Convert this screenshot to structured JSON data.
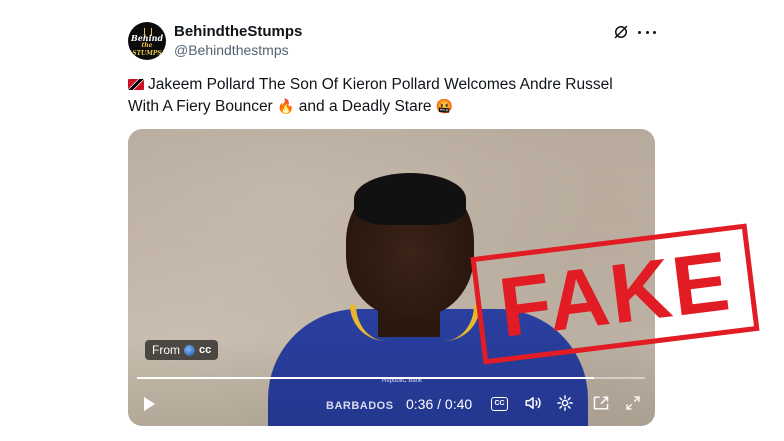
{
  "account": {
    "display_name": "BehindtheStumps",
    "handle": "@Behindthestmps",
    "avatar_icon": "behind-the-stumps-logo"
  },
  "header_actions": {
    "grok_icon": "grok-icon",
    "more_icon": "more-icon"
  },
  "tweet": {
    "text_line1": "Jakeem Pollard The Son Of Kieron Pollard Welcomes Andre Russel",
    "text_line2_a": "With A Fiery Bouncer",
    "emoji_fire": "🔥",
    "text_line2_b": "and a Deadly Stare",
    "emoji_face": "🤬",
    "flag_icon": "trinidad-tobago-flag-icon"
  },
  "video": {
    "jersey_text": "BARBADOS",
    "jersey_sponsor": "RepubliC Bank",
    "watermark": "FAKE",
    "from_label": "From",
    "from_cc": "cc",
    "time": "0:36 / 0:40",
    "progress": 0.9,
    "cc_label": "CC"
  },
  "colors": {
    "stamp": "#e11c24",
    "jersey": "#2a3fa0"
  }
}
